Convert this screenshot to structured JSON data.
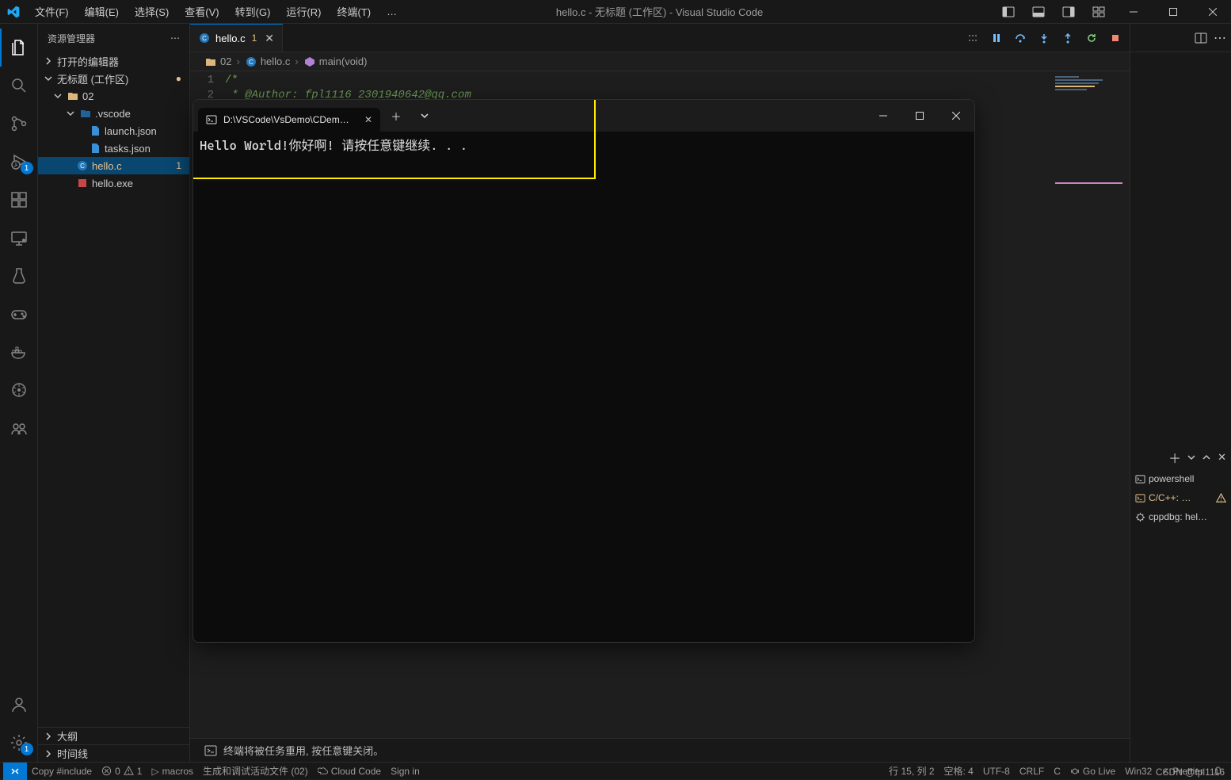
{
  "titlebar": {
    "title": "hello.c - 无标题 (工作区) - Visual Studio Code",
    "menus": [
      "文件(F)",
      "编辑(E)",
      "选择(S)",
      "查看(V)",
      "转到(G)",
      "运行(R)",
      "终端(T)",
      "…"
    ]
  },
  "activity": {
    "items": [
      {
        "name": "explorer",
        "active": true
      },
      {
        "name": "search",
        "active": false
      },
      {
        "name": "source-control",
        "active": false
      },
      {
        "name": "run-debug",
        "active": false,
        "badge": "1"
      },
      {
        "name": "extensions",
        "active": false
      },
      {
        "name": "remote-explorer",
        "active": false
      },
      {
        "name": "testing",
        "active": false
      },
      {
        "name": "game",
        "active": false
      },
      {
        "name": "docker",
        "active": false
      },
      {
        "name": "kubernetes",
        "active": false
      },
      {
        "name": "live-share",
        "active": false
      }
    ],
    "bottom": [
      {
        "name": "accounts"
      },
      {
        "name": "settings",
        "badge": "1"
      }
    ]
  },
  "sidebar": {
    "title": "资源管理器",
    "openEditors": "打开的编辑器",
    "workspace": "无标题 (工作区)",
    "folder": "02",
    "vscodeFolder": ".vscode",
    "files": {
      "launch": "launch.json",
      "tasks": "tasks.json",
      "helloC": "hello.c",
      "helloExe": "hello.exe"
    },
    "helloCDirty": "1",
    "outline": "大纲",
    "timeline": "时间线"
  },
  "tabs": {
    "active": {
      "label": "hello.c",
      "dirty": "1"
    }
  },
  "breadcrumbs": {
    "items": [
      "02",
      "hello.c",
      "main(void)"
    ]
  },
  "editor": {
    "line1No": "1",
    "line2No": "2",
    "line1": "/*",
    "line2": " * @Author: fpl1116 2301940642@qq.com"
  },
  "terminalPanel": {
    "powershell": "powershell",
    "cpp": "C/C++: …",
    "cppdbg": "cppdbg: hel…"
  },
  "terminalHint": "终端将被任务重用, 按任意键关闭。",
  "externalTerminal": {
    "tabTitle": "D:\\VSCode\\VsDemo\\CDemo\\C",
    "output": "Hello World!你好啊! 请按任意键继续. . ."
  },
  "statusbar": {
    "copy": "Copy #include",
    "errors": "0",
    "warnings": "1",
    "macros": "macros",
    "taskBuild": "生成和调试活动文件 (02)",
    "cloudCode": "Cloud Code",
    "signIn": "Sign in",
    "cursor": "行 15, 列 2",
    "spaces": "空格: 4",
    "encoding": "UTF-8",
    "eol": "CRLF",
    "lang": "C",
    "goLive": "Go Live",
    "win32": "Win32",
    "prettier": "Prettier"
  },
  "watermark": "CSDN @fpl1116"
}
